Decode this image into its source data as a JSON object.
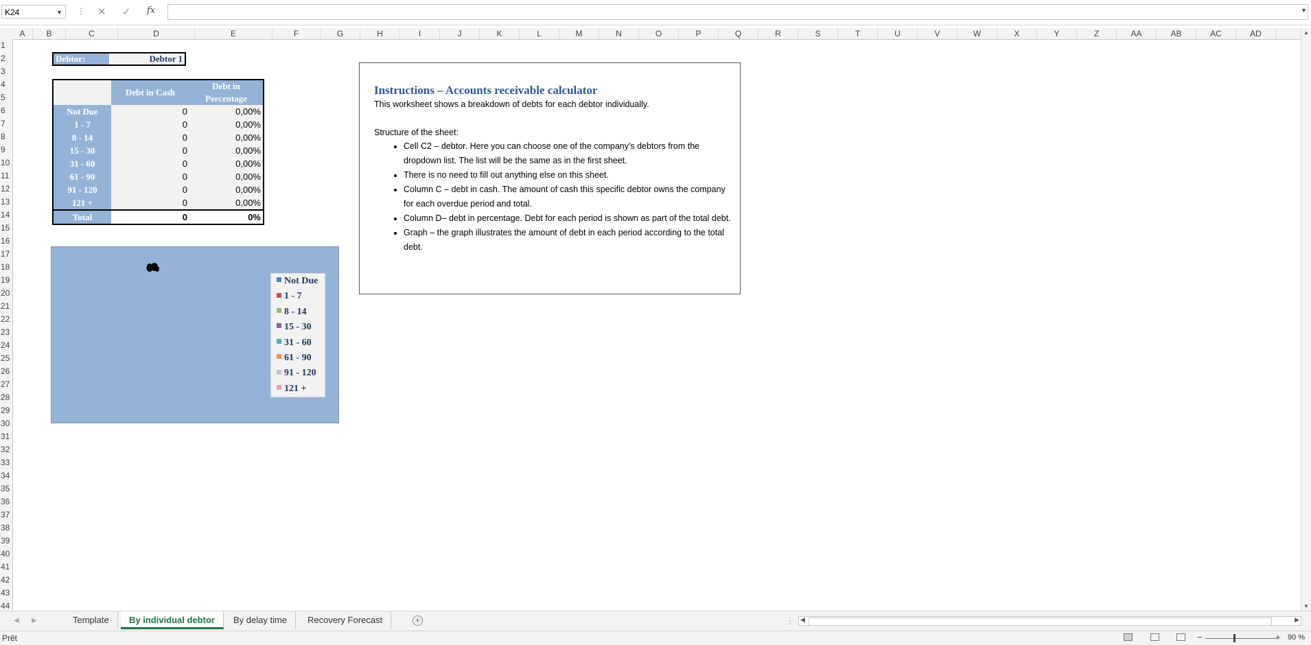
{
  "formula_bar": {
    "name_box": "K24",
    "cancel_icon": "✕",
    "enter_icon": "✓",
    "fx_label": "fx",
    "formula": ""
  },
  "columns": [
    "A",
    "B",
    "C",
    "D",
    "E",
    "F",
    "G",
    "H",
    "I",
    "J",
    "K",
    "L",
    "M",
    "N",
    "O",
    "P",
    "Q",
    "R",
    "S",
    "T",
    "U",
    "V",
    "W",
    "X",
    "Y",
    "Z",
    "AA",
    "AB",
    "AC",
    "AD"
  ],
  "rows": [
    "1",
    "2",
    "3",
    "4",
    "5",
    "6",
    "7",
    "8",
    "9",
    "10",
    "11",
    "12",
    "13",
    "14",
    "15",
    "16",
    "17",
    "18",
    "19",
    "20",
    "21",
    "22",
    "23",
    "24",
    "25",
    "26",
    "27",
    "28",
    "29",
    "30",
    "31",
    "32",
    "33",
    "34",
    "35",
    "36",
    "37",
    "38",
    "39",
    "40",
    "41",
    "42",
    "43",
    "44"
  ],
  "debtor": {
    "label": "Debtor:",
    "value": "Debtor 1"
  },
  "debt_table": {
    "header_cash": "Debt in Cash",
    "header_pct": "Debt in Percentage",
    "rows": [
      {
        "label": "Not Due",
        "cash": "0",
        "pct": "0,00%"
      },
      {
        "label": "1 - 7",
        "cash": "0",
        "pct": "0,00%"
      },
      {
        "label": "8 - 14",
        "cash": "0",
        "pct": "0,00%"
      },
      {
        "label": "15 - 30",
        "cash": "0",
        "pct": "0,00%"
      },
      {
        "label": "31 - 60",
        "cash": "0",
        "pct": "0,00%"
      },
      {
        "label": "61 - 90",
        "cash": "0",
        "pct": "0,00%"
      },
      {
        "label": "91 - 120",
        "cash": "0",
        "pct": "0,00%"
      },
      {
        "label": "121 +",
        "cash": "0",
        "pct": "0,00%"
      }
    ],
    "total_label": "Total",
    "total_cash": "0",
    "total_pct": "0%"
  },
  "chart_data": {
    "type": "pie",
    "title": "",
    "categories": [
      "Not Due",
      "1 - 7",
      "8 - 14",
      "15 - 30",
      "31 - 60",
      "61 - 90",
      "91 - 120",
      "121 +"
    ],
    "values": [
      0,
      0,
      0,
      0,
      0,
      0,
      0,
      0
    ],
    "legend_position": "right",
    "legend": [
      {
        "label": "Not Due",
        "color": "#4f81bd"
      },
      {
        "label": "1 - 7",
        "color": "#c0504d"
      },
      {
        "label": "8 - 14",
        "color": "#9bbb59"
      },
      {
        "label": "15 - 30",
        "color": "#8064a2"
      },
      {
        "label": "31 - 60",
        "color": "#4bacc6"
      },
      {
        "label": "61 - 90",
        "color": "#f79646"
      },
      {
        "label": "91 - 120",
        "color": "#c4c4c4"
      },
      {
        "label": "121 +",
        "color": "#e6a5a4"
      }
    ]
  },
  "instructions": {
    "title": "Instructions – Accounts receivable calculator",
    "intro": "This worksheet shows a breakdown of debts for each debtor individually.",
    "structure_heading": "Structure of the sheet:",
    "items": [
      "Cell C2 – debtor. Here you can choose one of the company's debtors from the dropdown list. The list will be the same as in the first sheet.",
      "There is no need to fill out anything else on this sheet.",
      "Column C – debt in cash. The amount of cash this specific debtor owns the company for each overdue period and total.",
      "Column D– debt in percentage. Debt for each period is shown as part of the total debt.",
      "Graph – the graph illustrates the amount of debt in each period according to the total debt."
    ]
  },
  "sheet_tabs": {
    "tabs": [
      "Template",
      "By individual debtor",
      "By delay time",
      "Recovery Forecast"
    ],
    "active": "By individual debtor"
  },
  "status_bar": {
    "status": "Prêt",
    "zoom": "90 %"
  },
  "colors": {
    "accent_blue": "#95b3d7",
    "title_blue": "#2f5597",
    "active_tab_green": "#217346"
  }
}
